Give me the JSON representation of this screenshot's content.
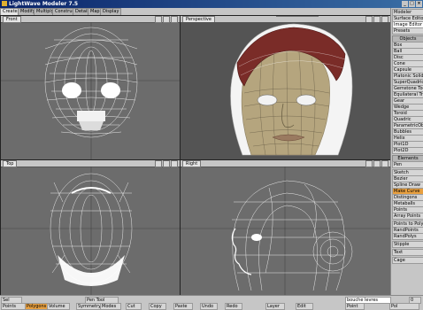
{
  "window": {
    "title": "LightWave Modeler 7.5"
  },
  "tabs": [
    "Create",
    "Modify",
    "Multiply",
    "Construct",
    "Detail",
    "Map",
    "Display"
  ],
  "viewports": {
    "top_left": {
      "label": "Front"
    },
    "top_right": {
      "label": "Perspective"
    },
    "bottom_left": {
      "label": "Top"
    },
    "bottom_right": {
      "label": "Right"
    }
  },
  "surface_field": "tete_cheveux_haut",
  "right_panel": {
    "top_buttons": [
      "Modeler",
      "Surface Editor",
      "Image Editor",
      "Presets"
    ],
    "objects_header": "Objects",
    "objects": [
      "Box",
      "Ball",
      "Disc",
      "Cone",
      "Capsule",
      "Platonic Solid",
      "SuperQuadric",
      "Gemstone Tool",
      "Equilateral Tri.",
      "Gear",
      "Wedge",
      "Toroid",
      "Quadric",
      "ParametricObj",
      "Bubbles",
      "Helix",
      "Plot1D",
      "Plot2D"
    ],
    "elements_header": "Elements",
    "elements": [
      "Pen",
      "Sketch",
      "Bezier",
      "Spline Draw",
      "Make Curve",
      "Distingons",
      "Metaballs",
      "Points",
      "Array Points",
      "RandPoints",
      "RandPolys",
      "Stipple",
      "Cage"
    ],
    "text_row": "Text",
    "misc_rows": [
      "Points to Polys",
      "Cage"
    ]
  },
  "statusbar": {
    "row1": [
      "Sel",
      "Pen Tool",
      "bouche levres"
    ],
    "row2": [
      "Points",
      "Polygons",
      "Volume",
      "Symmetry",
      "Modes",
      "Cut",
      "Copy",
      "Paste",
      "Undo",
      "Redo",
      "Layer",
      "Edit",
      "Point",
      "Pol"
    ],
    "extra": "0"
  }
}
